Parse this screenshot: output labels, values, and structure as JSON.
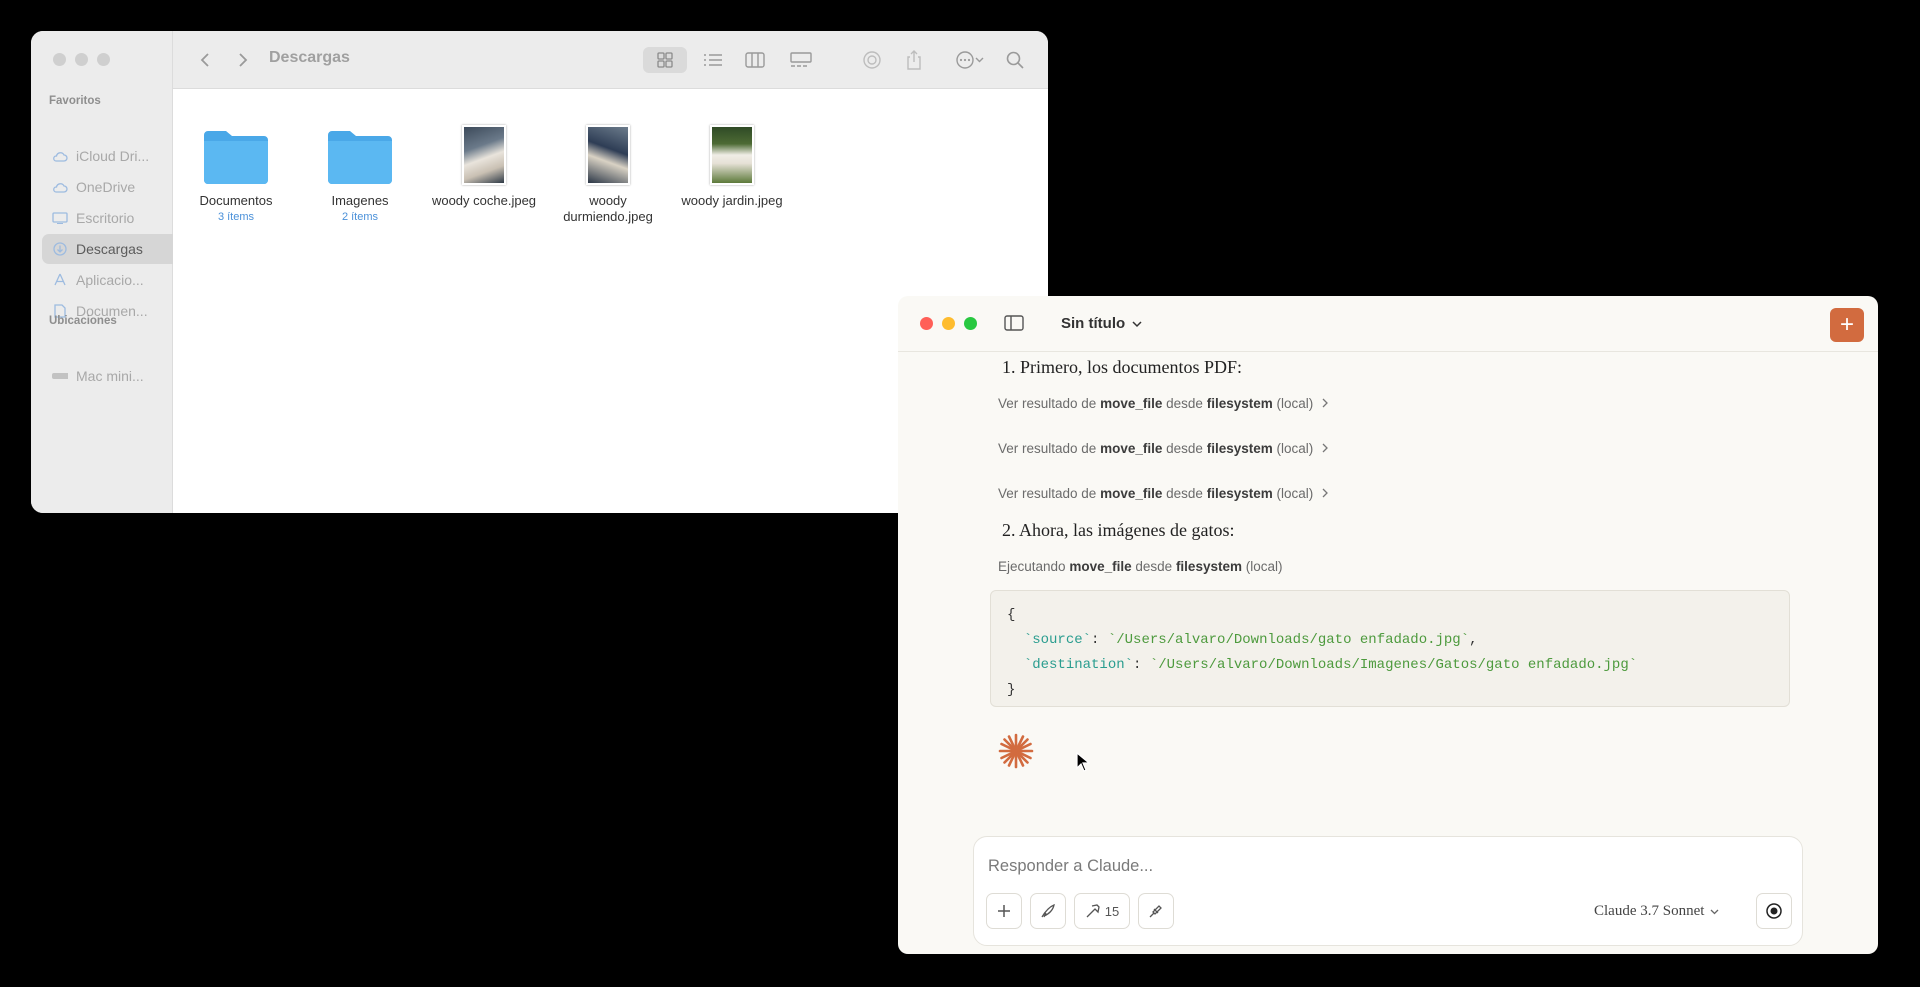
{
  "finder": {
    "title": "Descargas",
    "sidebar": {
      "favorites_label": "Favoritos",
      "locations_label": "Ubicaciones",
      "items": [
        {
          "label": "iCloud Dri...",
          "icon": "cloud-icon"
        },
        {
          "label": "OneDrive",
          "icon": "cloud-icon"
        },
        {
          "label": "Escritorio",
          "icon": "desktop-icon"
        },
        {
          "label": "Descargas",
          "icon": "download-icon",
          "selected": true
        },
        {
          "label": "Aplicacio...",
          "icon": "apps-icon"
        },
        {
          "label": "Documen...",
          "icon": "document-icon"
        }
      ],
      "locations": [
        {
          "label": "Mac mini...",
          "icon": "drive-icon"
        }
      ]
    },
    "files": [
      {
        "name": "Documentos",
        "sub": "3 ítems",
        "kind": "folder"
      },
      {
        "name": "Imagenes",
        "sub": "2 ítems",
        "kind": "folder"
      },
      {
        "name": "woody coche.jpeg",
        "kind": "image"
      },
      {
        "name": "woody durmiendo.jpeg",
        "kind": "image"
      },
      {
        "name": "woody jardin.jpeg",
        "kind": "image"
      }
    ]
  },
  "claude": {
    "title": "Sin título",
    "step1": "1. Primero, los documentos PDF:",
    "step2": "2. Ahora, las imágenes de gatos:",
    "tool_results": [
      {
        "prefix": "Ver resultado de",
        "tool": "move_file",
        "mid": "desde",
        "server": "filesystem",
        "suffix": "(local)"
      },
      {
        "prefix": "Ver resultado de",
        "tool": "move_file",
        "mid": "desde",
        "server": "filesystem",
        "suffix": "(local)"
      },
      {
        "prefix": "Ver resultado de",
        "tool": "move_file",
        "mid": "desde",
        "server": "filesystem",
        "suffix": "(local)"
      }
    ],
    "running": {
      "prefix": "Ejecutando",
      "tool": "move_file",
      "mid": "desde",
      "server": "filesystem",
      "suffix": "(local)"
    },
    "code": {
      "open": "{",
      "source_key": "`source`",
      "source_val": "`/Users/alvaro/Downloads/gato enfadado.jpg`",
      "dest_key": "`destination`",
      "dest_val": "`/Users/alvaro/Downloads/Imagenes/Gatos/gato enfadado.jpg`",
      "close": "}"
    },
    "composer": {
      "placeholder": "Responder a Claude...",
      "tools_count": "15",
      "model": "Claude 3.7 Sonnet"
    },
    "accent": "#d26b3f"
  }
}
